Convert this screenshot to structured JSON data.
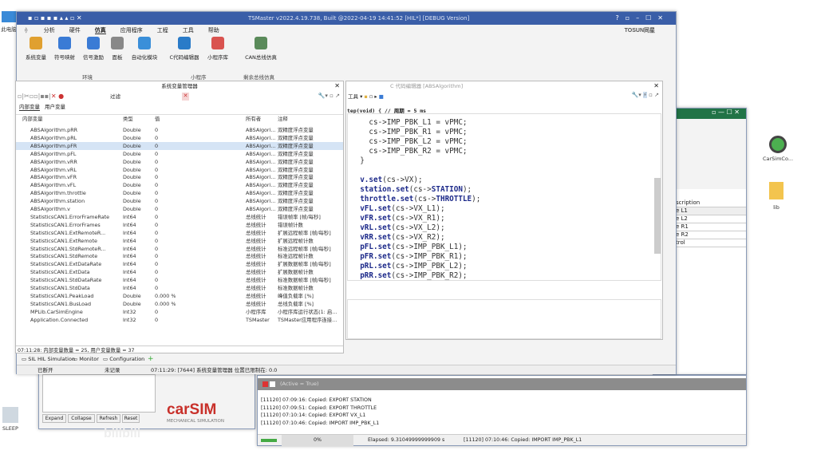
{
  "desktop": {
    "this_pc": "此电脑",
    "sleep": "SLEEP",
    "carsim_shortcut": "CarSimCo...",
    "lib_folder": "lib"
  },
  "app": {
    "title": "TSMaster v2022.4.19.738, Built @2022-04-19 14:41:52 [HIL*] [DEBUG Version]",
    "brand": "TOSUN同星",
    "menu": [
      "分析",
      "硬件",
      "仿真",
      "应用程序",
      "工程",
      "工具",
      "帮助"
    ],
    "active_menu": "仿真",
    "ribbon": [
      {
        "label": "系统变量",
        "color": "#e0a030"
      },
      {
        "label": "符号映射",
        "color": "#3a7bd5"
      },
      {
        "label": "信号激励",
        "color": "#3a7bd5"
      },
      {
        "label": "面板",
        "color": "#888"
      },
      {
        "label": "自动化模块",
        "color": "#3a8fd9"
      },
      {
        "label": "C代码编辑器",
        "color": "#2a7bc8"
      },
      {
        "label": "小程序库",
        "color": "#d9534f"
      },
      {
        "label": "CAN总线仿真",
        "color": "#5a8a5a"
      }
    ],
    "groups": [
      "环境",
      "小程序",
      "剩余总线仿真"
    ]
  },
  "varmgr": {
    "title": "系统变量管理器",
    "filter_label": "过滤",
    "tabs": [
      "内部变量",
      "用户变量"
    ],
    "headers": [
      "内部变量",
      "类型",
      "值",
      "所有者",
      "注释"
    ],
    "rows": [
      [
        "ABSAlgorithm.pRR",
        "Double",
        "0",
        "ABSAlgori...",
        "双精度浮点变量"
      ],
      [
        "ABSAlgorithm.pRL",
        "Double",
        "0",
        "ABSAlgori...",
        "双精度浮点变量"
      ],
      [
        "ABSAlgorithm.pFR",
        "Double",
        "0",
        "ABSAlgori...",
        "双精度浮点变量"
      ],
      [
        "ABSAlgorithm.pFL",
        "Double",
        "0",
        "ABSAlgori...",
        "双精度浮点变量"
      ],
      [
        "ABSAlgorithm.vRR",
        "Double",
        "0",
        "ABSAlgori...",
        "双精度浮点变量"
      ],
      [
        "ABSAlgorithm.vRL",
        "Double",
        "0",
        "ABSAlgori...",
        "双精度浮点变量"
      ],
      [
        "ABSAlgorithm.vFR",
        "Double",
        "0",
        "ABSAlgori...",
        "双精度浮点变量"
      ],
      [
        "ABSAlgorithm.vFL",
        "Double",
        "0",
        "ABSAlgori...",
        "双精度浮点变量"
      ],
      [
        "ABSAlgorithm.throttle",
        "Double",
        "0",
        "ABSAlgori...",
        "双精度浮点变量"
      ],
      [
        "ABSAlgorithm.station",
        "Double",
        "0",
        "ABSAlgori...",
        "双精度浮点变量"
      ],
      [
        "ABSAlgorithm.v",
        "Double",
        "0",
        "ABSAlgori...",
        "双精度浮点变量"
      ],
      [
        "StatisticsCAN1.ErrorFrameRate",
        "Int64",
        "0",
        "总线统计",
        "错误帧率 [帧/每秒]"
      ],
      [
        "StatisticsCAN1.ErrorFrames",
        "Int64",
        "0",
        "总线统计",
        "错误帧计数"
      ],
      [
        "StatisticsCAN1.ExtRemoteR...",
        "Int64",
        "0",
        "总线统计",
        "扩展远程帧率 [帧/每秒]"
      ],
      [
        "StatisticsCAN1.ExtRemote",
        "Int64",
        "0",
        "总线统计",
        "扩展远程帧计数"
      ],
      [
        "StatisticsCAN1.StdRemoteR...",
        "Int64",
        "0",
        "总线统计",
        "标准远程帧率 [帧/每秒]"
      ],
      [
        "StatisticsCAN1.StdRemote",
        "Int64",
        "0",
        "总线统计",
        "标准远程帧计数"
      ],
      [
        "StatisticsCAN1.ExtDataRate",
        "Int64",
        "0",
        "总线统计",
        "扩展数据帧率 [帧/每秒]"
      ],
      [
        "StatisticsCAN1.ExtData",
        "Int64",
        "0",
        "总线统计",
        "扩展数据帧计数"
      ],
      [
        "StatisticsCAN1.StdDataRate",
        "Int64",
        "0",
        "总线统计",
        "标准数据帧率 [帧/每秒]"
      ],
      [
        "StatisticsCAN1.StdData",
        "Int64",
        "0",
        "总线统计",
        "标准数据帧计数"
      ],
      [
        "StatisticsCAN1.PeakLoad",
        "Double",
        "0.000 %",
        "总线统计",
        "峰值负载率 [%]"
      ],
      [
        "StatisticsCAN1.BusLoad",
        "Double",
        "0.000 %",
        "总线统计",
        "总线负载率 [%]"
      ],
      [
        "MPLib.CarSimEngine",
        "Int32",
        "0",
        "小程序库",
        "小程序库运行状态(1: 启..."
      ],
      [
        "Application.Connected",
        "Int32",
        "0",
        "TSMaster",
        "TSMaster应用程序连接..."
      ]
    ],
    "selected_row": 2,
    "status": "07:11:28: 内部变量数量 = 25, 用户变量数量 = 37"
  },
  "bottom_tabs": [
    "SIL HIL Simulation",
    "Monitor",
    "Configuration"
  ],
  "statusbar": {
    "conn": "已断开",
    "rec": "未记录",
    "msg": "07:11:29: [7644] 系统变量管理器 位置已限制在: 0.0"
  },
  "editor": {
    "title": "C 代码编辑器 [ABSAlgorithm]",
    "tools": "工具",
    "func_line": "tep(void) { // 周期 = 5 ms",
    "lines": [
      [
        [
          "",
          "    cs->IMP_PBK_L1 = vPMC;"
        ]
      ],
      [
        [
          "",
          "    cs->IMP_PBK_R1 = vPMC;"
        ]
      ],
      [
        [
          "",
          "    cs->IMP_PBK_L2 = vPMC;"
        ]
      ],
      [
        [
          "",
          "    cs->IMP_PBK_R2 = vPMC;"
        ]
      ],
      [
        [
          "",
          "  }"
        ]
      ],
      [
        [
          "",
          ""
        ]
      ],
      [
        [
          "kw",
          "  v.set"
        ],
        [
          "",
          "(cs->VX);"
        ]
      ],
      [
        [
          "kw",
          "  station.set"
        ],
        [
          "",
          "(cs->"
        ],
        [
          "kw",
          "STATION"
        ],
        [
          "",
          ");"
        ]
      ],
      [
        [
          "kw",
          "  throttle.set"
        ],
        [
          "",
          "(cs->"
        ],
        [
          "kw",
          "THROTTLE"
        ],
        [
          "",
          ");"
        ]
      ],
      [
        [
          "kw",
          "  vFL.set"
        ],
        [
          "",
          "(cs->VX_L1);"
        ]
      ],
      [
        [
          "kw",
          "  vFR.set"
        ],
        [
          "",
          "(cs->VX_R1);"
        ]
      ],
      [
        [
          "kw",
          "  vRL.set"
        ],
        [
          "",
          "(cs->VX_L2);"
        ]
      ],
      [
        [
          "kw",
          "  vRR.set"
        ],
        [
          "",
          "(cs->VX_R2);"
        ]
      ],
      [
        [
          "kw",
          "  pFL.set"
        ],
        [
          "",
          "(cs->IMP_PBK_L1);"
        ]
      ],
      [
        [
          "kw",
          "  pFR.set"
        ],
        [
          "",
          "(cs->IMP_PBK_R1);"
        ]
      ],
      [
        [
          "kw",
          "  pRL.set"
        ],
        [
          "",
          "(cs->IMP_PBK_L2);"
        ]
      ],
      [
        [
          "kw",
          "  pRR.set"
        ],
        [
          "",
          "(cs->IMP_PBK_R2);"
        ]
      ]
    ]
  },
  "excel": {
    "rows": [
      "scription",
      "e L1",
      "e L2",
      "e R1",
      "e R2",
      "trol"
    ]
  },
  "carsim": {
    "buttons": [
      "Expand",
      "Collapse",
      "Refresh",
      "Reset"
    ],
    "logo": "carSIM",
    "logo_sub": "MECHANICAL SIMULATION"
  },
  "log": {
    "header": "(Active = True)",
    "lines": [
      "[11120] 07:09:16: Copied: EXPORT STATION",
      "[11120] 07:09:51: Copied: EXPORT THROTTLE",
      "[11120] 07:10:14: Copied: EXPORT VX_L1",
      "[11120] 07:10:46: Copied: IMPORT IMP_PBK_L1"
    ],
    "progress": "0%",
    "progress_value": 0,
    "elapsed": "Elapsed: 9.31049999999909 s",
    "last": "[11120] 07:10:46: Copied: IMPORT IMP_PBK_L1"
  },
  "watermark": "bilibili"
}
